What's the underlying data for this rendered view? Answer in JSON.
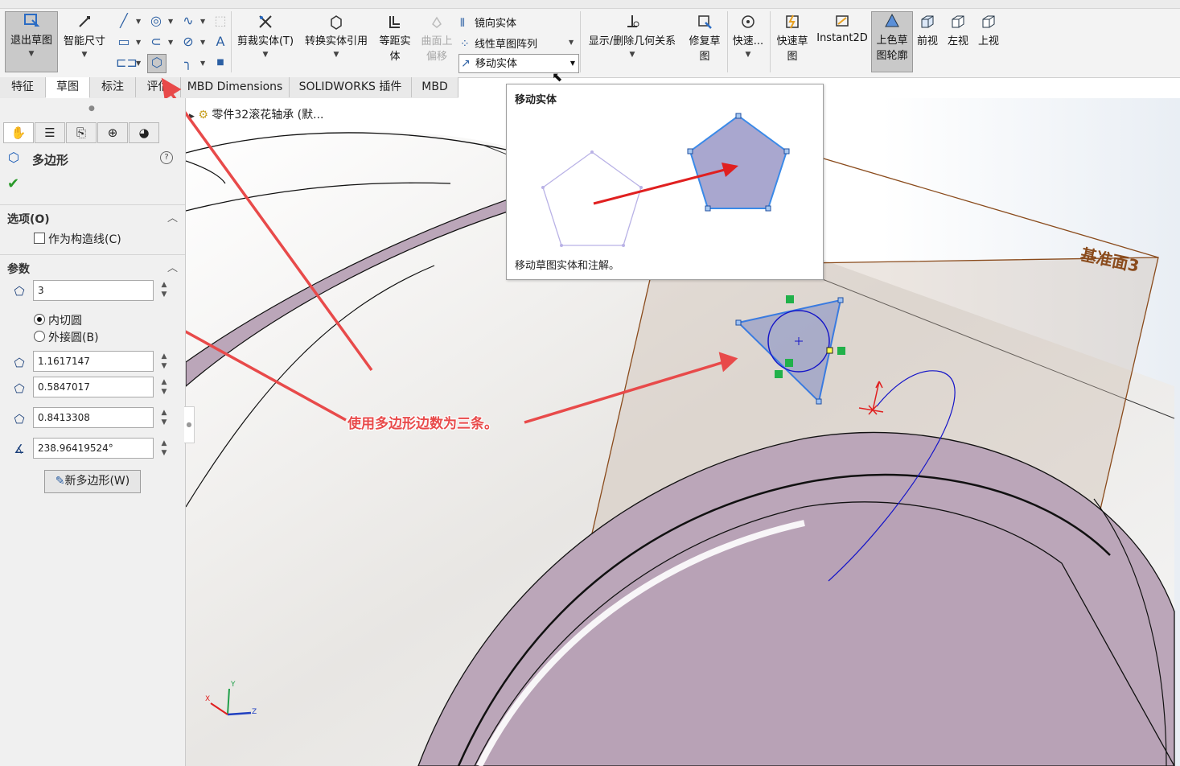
{
  "ribbon": {
    "exit_sketch": "退出草图",
    "smart_dimension": "智能尺寸",
    "trim_entities": "剪裁实体(T)",
    "convert_entities": "转换实体引用",
    "offset_entities_line1": "等距实",
    "offset_entities_line2": "体",
    "offset_on_surface_line1": "曲面上",
    "offset_on_surface_line2": "偏移",
    "mirror_entities": "镜向实体",
    "linear_pattern": "线性草图阵列",
    "move_entities": "移动实体",
    "display_delete_relations": "显示/删除几何关系",
    "repair_sketch_line1": "修复草",
    "repair_sketch_line2": "图",
    "quick_snaps": "快速...",
    "rapid_sketch_line1": "快速草",
    "rapid_sketch_line2": "图",
    "instant2d": "Instant2D",
    "shaded_sketch_line1": "上色草",
    "shaded_sketch_line2": "图轮廓",
    "front_view": "前视",
    "left_view": "左视",
    "top_view": "上视"
  },
  "tabs": [
    "特征",
    "草图",
    "标注",
    "评估",
    "MBD Dimensions",
    "SOLIDWORKS 插件",
    "MBD"
  ],
  "active_tab": "草图",
  "tree": {
    "part_name": "零件32滚花轴承 (默..."
  },
  "panel": {
    "title": "多边形",
    "options_header": "选项(O)",
    "construction_label": "作为构造线(C)",
    "params_header": "参数",
    "sides": "3",
    "inscribed": "内切圆",
    "circumscribed": "外接圆(B)",
    "center_x": "1.1617147",
    "center_y": "0.5847017",
    "diameter": "0.8413308",
    "angle": "238.96419524°",
    "new_polygon": "新多边形(W)"
  },
  "tooltip": {
    "title": "移动实体",
    "description": "移动草图实体和注解。"
  },
  "viewport": {
    "plane_label": "基准面3",
    "annotation": "使用多边形边数为三条。",
    "axis_x": "X",
    "axis_y": "Y",
    "axis_z": "Z"
  },
  "colors": {
    "ribbon_bg": "#f3f3f3",
    "panel_bg": "#f0f0f0",
    "part_fill": "#bba6b9",
    "plane_edge": "#8a4b1c",
    "sketch_blue": "#3a7be0",
    "annotation_red": "#e84a4a"
  }
}
